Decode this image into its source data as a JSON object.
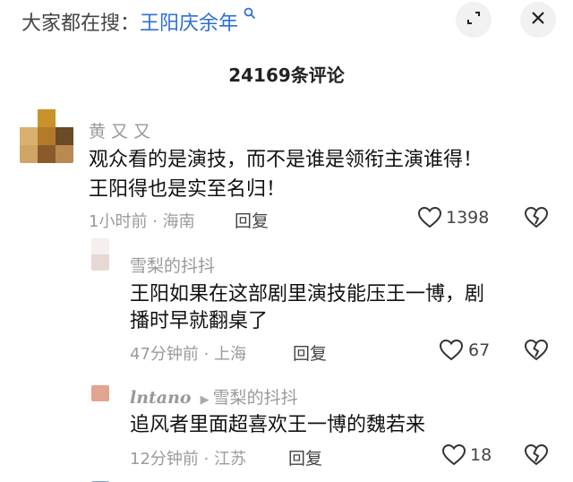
{
  "search": {
    "prefix": "大家都在搜：",
    "query": "王阳庆余年",
    "query_icon": "search-icon"
  },
  "header": {
    "comment_count": "24169条评论",
    "collapse_icon": "collapse-icon",
    "close_icon": "close-icon"
  },
  "comments": [
    {
      "user": "黄 又 又",
      "text_line1": "观众看的是演技，而不是谁是领衔主演谁得！",
      "text_line2": "王阳得也是实至名归！",
      "meta": "1小时前 · 海南",
      "reply_label": "回复",
      "likes": "1398"
    }
  ],
  "replies": [
    {
      "user": "雪梨的抖抖",
      "text_line1": "王阳如果在这部剧里演技能压王一博，剧",
      "text_line2": "播时早就翻桌了",
      "meta": "47分钟前 · 上海",
      "reply_label": "回复",
      "likes": "67"
    },
    {
      "user": "lntano",
      "reply_to": "雪梨的抖抖",
      "text_line1": "追风者里面超喜欢王一博的魏若来",
      "meta": "12分钟前 · 江苏",
      "reply_label": "回复",
      "likes": "18"
    }
  ],
  "colors": {
    "link_blue": "#2d6fd6",
    "meta_gray": "#9a9a9a"
  }
}
